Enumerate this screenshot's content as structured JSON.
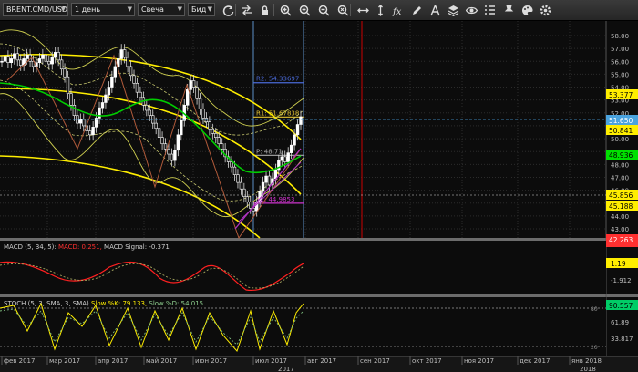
{
  "toolbar": {
    "symbol": "BRENT.CMD/USD",
    "timeframe": "1 день",
    "chart_type": "Свеча",
    "price_type": "Бид",
    "icons": [
      "refresh-icon",
      "arrows-icon",
      "lock-icon",
      "zoom-in-icon",
      "zoom-fit-icon",
      "zoom-out-icon",
      "zoom-reset-icon",
      "fit-width-icon",
      "fit-height-icon",
      "fx-icon",
      "pencil-icon",
      "text-style-icon",
      "layers-icon",
      "eye-icon",
      "checklist-icon",
      "pin-icon",
      "palette-icon",
      "settings-icon"
    ]
  },
  "price_scale": {
    "ticks": [
      "58.00",
      "57.00",
      "56.00",
      "55.00",
      "54.00",
      "53.00",
      "52.00",
      "51.00",
      "50.00",
      "49.00",
      "48.00",
      "47.00",
      "46.00",
      "45.00",
      "44.00",
      "43.00"
    ],
    "labels": [
      {
        "text": "53.377",
        "color": "#ffee00"
      },
      {
        "text": "51.650",
        "color": "#4aa3df"
      },
      {
        "text": "50.841",
        "color": "#ffee00"
      },
      {
        "text": "48.936",
        "color": "#00e000"
      },
      {
        "text": "45.856",
        "color": "#ffee00"
      },
      {
        "text": "45.188",
        "color": "#ffee00"
      },
      {
        "text": "42.263",
        "color": "#ff3030"
      }
    ]
  },
  "pivot_labels": {
    "r2": "R2: 54.33697",
    "r1": "R1: 51.67838",
    "p": "P: 48.71",
    "s1": "S1: 44.9853"
  },
  "macd": {
    "title": "MACD (5, 34, 5):",
    "value_label": "MACD: 0.251",
    "signal_label": "MACD Signal: -0.371",
    "current": "1.19",
    "ticks": [
      "-1.912"
    ]
  },
  "stoch": {
    "title": "STOCH (5, 3, SMA, 3, SMA)",
    "k_label": "Slow %K: 79.133",
    "d_label": "Slow %D: 54.015",
    "current": "90.557",
    "ticks": [
      "61.89",
      "33.817"
    ],
    "level_80": "80",
    "level_20": "20"
  },
  "time_axis": {
    "months": [
      "фев 2017",
      "мар 2017",
      "апр 2017",
      "май 2017",
      "июн 2017",
      "июл 2017",
      "авг 2017",
      "сен 2017",
      "окт 2017",
      "ноя 2017",
      "дек 2017",
      "янв 2018"
    ],
    "year_left": "2017",
    "year_right": "2018"
  },
  "colors": {
    "up_candle": "#ffffff",
    "down_candle": "#ffffff",
    "sma": "#00cc00",
    "bands": "#ffee00",
    "envelope": "#eeee66",
    "macd_line": "#ff2020",
    "stoch_k": "#ffee00",
    "current_price": "#4aa3df",
    "vline": "#cc0000"
  }
}
